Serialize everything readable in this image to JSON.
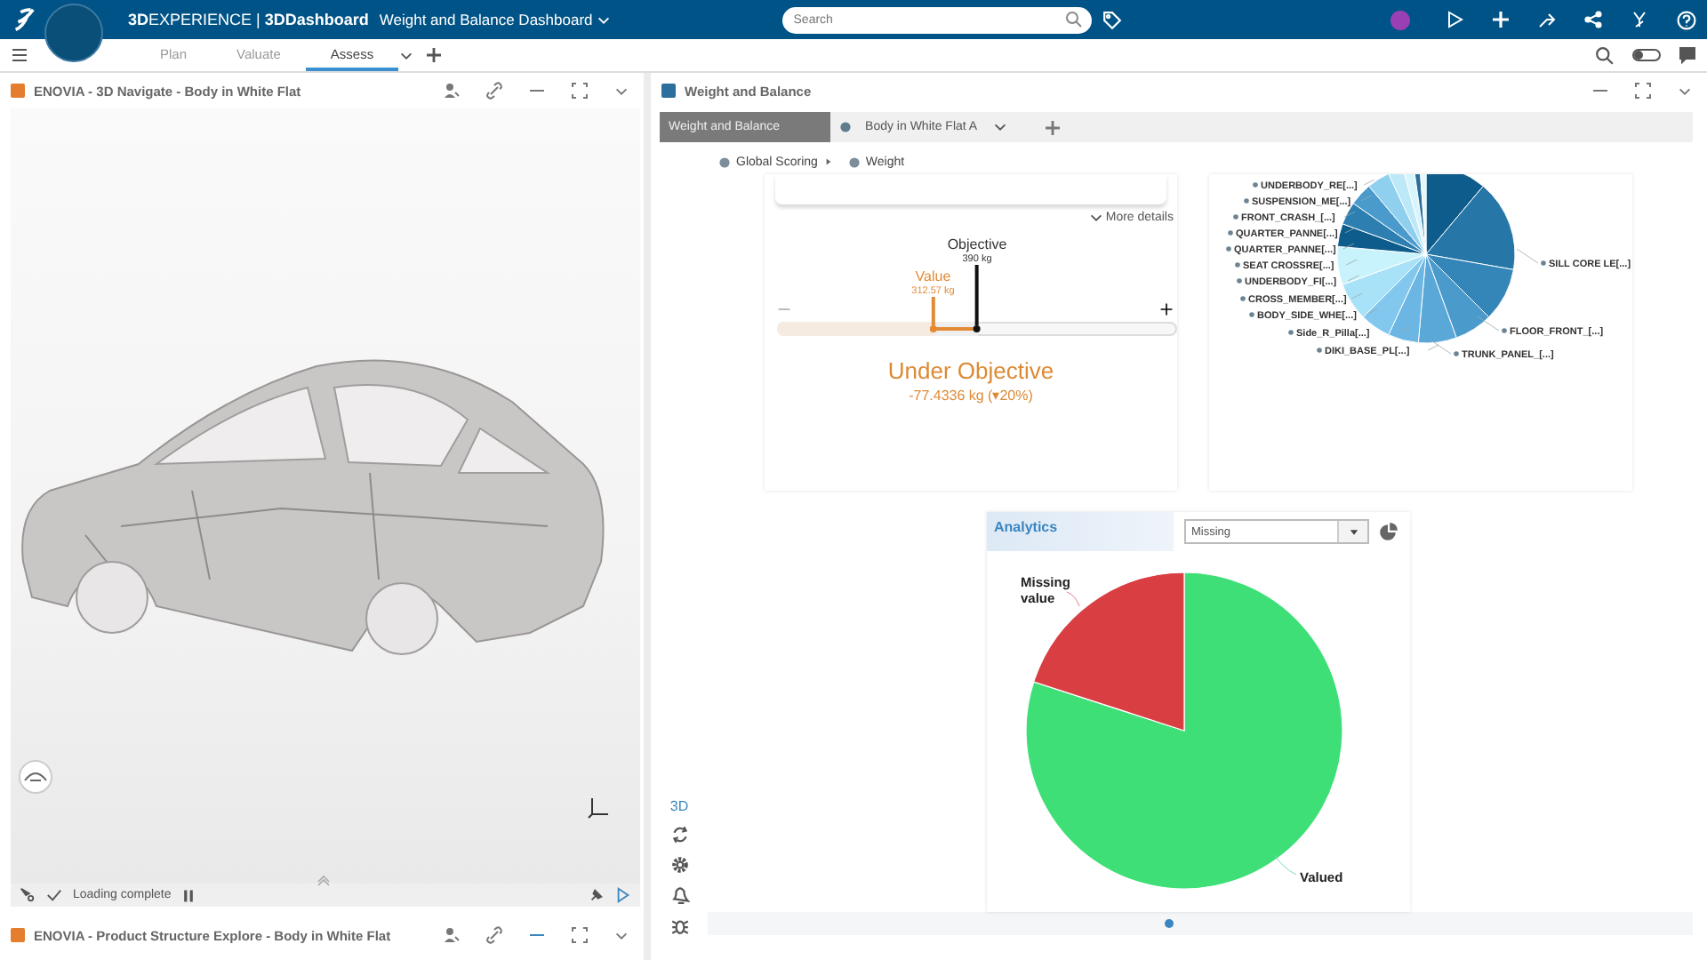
{
  "top_bar": {
    "brand": "**3D**EXPERIENCE | **3DDashboard**",
    "dashboard_title": "Weight and Balance Dashboard",
    "search": {
      "placeholder": "Search"
    }
  },
  "dashboard_tabs": [
    {
      "label": "Plan",
      "selected": false
    },
    {
      "label": "Valuate",
      "selected": false
    },
    {
      "label": "Assess",
      "selected": true
    }
  ],
  "left_panel": {
    "title": "ENOVIA - 3D Navigate - Body in White Flat",
    "status": "Loading complete"
  },
  "bottom_panel": {
    "title": "ENOVIA - Product Structure Explore - Body in White Flat"
  },
  "right_panel": {
    "title": "Weight and Balance",
    "tabs": [
      {
        "label": "Weight and Balance",
        "selected": true
      },
      {
        "label": "Body in White Flat A",
        "selected": false
      }
    ],
    "breadcrumb": [
      "Global Scoring",
      "Weight"
    ],
    "toolbar_label": "3D"
  },
  "gauge": {
    "more_details": "More details",
    "objective": {
      "label": "Objective",
      "reading": "390 kg",
      "level": 0.5
    },
    "value": {
      "label": "Value",
      "reading": "312.57 kg",
      "level": 0.39
    },
    "status": "Under Objective",
    "delta": "-77.4336 kg (▾20%)"
  },
  "weight_chart": {
    "slice_labels": [
      "UNDERBODY_RE[...]",
      "SUSPENSION_ME[...]",
      "FRONT_CRASH_[...]",
      "QUARTER_PANNE[...]",
      "QUARTER_PANNE[...]",
      "SEAT CROSSRE[...]",
      "UNDERBODY_FI[...]",
      "CROSS_MEMBER[...]",
      "BODY_SIDE_WHE[...]",
      "Side_R_Pilla[...]",
      "DIKI_BASE_PL[...]",
      "SILL CORE LE[...]",
      "FLOOR_FRONT_[...]",
      "TRUNK_PANEL_[...]"
    ]
  },
  "analytics": {
    "title": "Analytics",
    "filter": "Missing",
    "slice_labels": [
      "Missing value",
      "Valued"
    ]
  }
}
